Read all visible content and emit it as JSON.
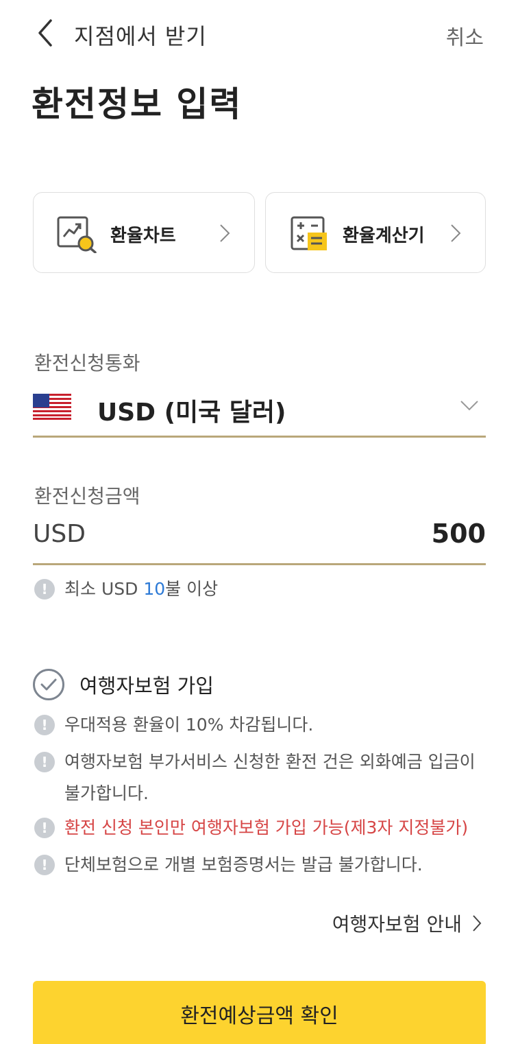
{
  "header": {
    "title": "지점에서 받기",
    "cancel_label": "취소"
  },
  "page_title": "환전정보 입력",
  "tools": [
    {
      "label": "환율차트",
      "icon": "chart-magnifier-icon"
    },
    {
      "label": "환율계산기",
      "icon": "calculator-icon"
    }
  ],
  "currency_field": {
    "label": "환전신청통화",
    "value": "USD (미국 달러)",
    "flag": "us-flag-icon"
  },
  "amount_field": {
    "label": "환전신청금액",
    "currency": "USD",
    "value": "500"
  },
  "min_notice": {
    "prefix": "최소 USD ",
    "amount": "10",
    "suffix": "불 이상"
  },
  "insurance": {
    "label": "여행자보험 가입",
    "notes": [
      "우대적용 환율이 10% 차감됩니다.",
      "여행자보험 부가서비스 신청한 환전 건은 외화예금 입금이",
      "불가합니다.",
      "환전 신청 본인만 여행자보험 가입 가능(제3자 지정불가)",
      "단체보험으로 개별 보험증명서는 발급 불가합니다."
    ],
    "guide_link": "여행자보험 안내"
  },
  "confirm_button": "환전예상금액 확인",
  "colors": {
    "accent_yellow": "#fdd32f",
    "underline_gold": "#b9a77a",
    "warning_red": "#d64545",
    "highlight_blue": "#2d7ad6"
  }
}
